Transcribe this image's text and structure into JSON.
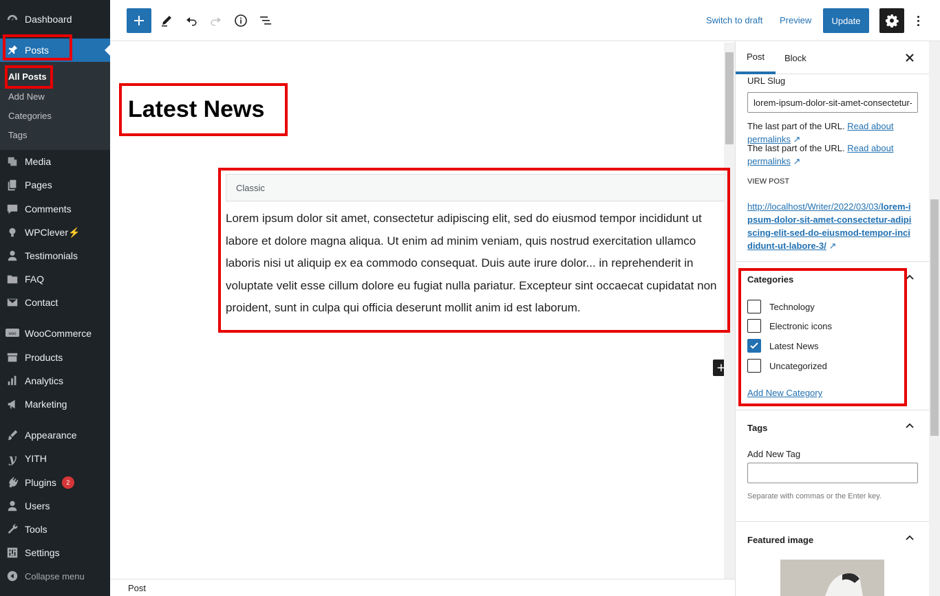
{
  "sidebar": {
    "items": [
      {
        "name": "menu-dashboard",
        "icon": "dashboard-icon",
        "label": "Dashboard"
      },
      {
        "name": "menu-posts",
        "icon": "pushpin-icon",
        "label": "Posts"
      },
      {
        "name": "menu-media",
        "icon": "media-icon",
        "label": "Media"
      },
      {
        "name": "menu-pages",
        "icon": "pages-icon",
        "label": "Pages"
      },
      {
        "name": "menu-comments",
        "icon": "comments-icon",
        "label": "Comments"
      },
      {
        "name": "menu-wpclever",
        "icon": "lightbulb-icon",
        "label": "WPClever⚡"
      },
      {
        "name": "menu-testimonials",
        "icon": "user-icon",
        "label": "Testimonials"
      },
      {
        "name": "menu-faq",
        "icon": "folder-icon",
        "label": "FAQ"
      },
      {
        "name": "menu-contact",
        "icon": "mail-icon",
        "label": "Contact"
      },
      {
        "name": "menu-woocommerce",
        "icon": "woo-icon",
        "label": "WooCommerce"
      },
      {
        "name": "menu-products",
        "icon": "archive-icon",
        "label": "Products"
      },
      {
        "name": "menu-analytics",
        "icon": "bar-chart-icon",
        "label": "Analytics"
      },
      {
        "name": "menu-marketing",
        "icon": "megaphone-icon",
        "label": "Marketing"
      },
      {
        "name": "menu-appearance",
        "icon": "brush-icon",
        "label": "Appearance"
      },
      {
        "name": "menu-yith",
        "icon": "yith-icon",
        "label": "YITH"
      },
      {
        "name": "menu-plugins",
        "icon": "plugin-icon",
        "label": "Plugins"
      },
      {
        "name": "menu-users",
        "icon": "users-icon",
        "label": "Users"
      },
      {
        "name": "menu-tools",
        "icon": "wrench-icon",
        "label": "Tools"
      },
      {
        "name": "menu-settings",
        "icon": "settings-icon",
        "label": "Settings"
      },
      {
        "name": "menu-collapse",
        "icon": "collapse-icon",
        "label": "Collapse menu"
      }
    ],
    "plugins_badge": "2",
    "submenu": [
      "All Posts",
      "Add New",
      "Categories",
      "Tags"
    ]
  },
  "toolbar": {
    "switch_to_draft": "Switch to draft",
    "preview": "Preview",
    "update": "Update"
  },
  "editor": {
    "title": "Latest News",
    "block_label": "Classic",
    "body": "Lorem ipsum dolor sit amet, consectetur adipiscing elit, sed do eiusmod tempor incididunt ut labore et dolore magna aliqua. Ut enim ad minim veniam, quis nostrud exercitation ullamco laboris nisi ut aliquip ex ea commodo consequat. Duis aute irure dolor... in reprehenderit in voluptate velit esse cillum dolore eu fugiat nulla pariatur. Excepteur sint occaecat cupidatat non proident, sunt in culpa qui officia deserunt mollit anim id est laborum.",
    "footer_breadcrumb": "Post"
  },
  "settings": {
    "tabs": [
      "Post",
      "Block"
    ],
    "url_slug_label": "URL Slug",
    "url_slug_value": "lorem-ipsum-dolor-sit-amet-consectetur-adipiscing-elit-sed-do-eiusmod-tempor-incididunt-ut-labore-3",
    "help_prefix": "The last part of the URL.",
    "help_link": "Read about permalinks",
    "view_post_label": "VIEW POST",
    "view_post_url_plain": "http://localhost/Writer/2022/03/03/",
    "view_post_url_bold": "lorem-ipsum-dolor-sit-amet-consectetur-adipiscing-elit-sed-do-eiusmod-tempor-incididunt-ut-labore-3/",
    "categories_title": "Categories",
    "categories": [
      {
        "label": "Technology",
        "checked": false
      },
      {
        "label": "Electronic icons",
        "checked": false
      },
      {
        "label": "Latest News",
        "checked": true
      },
      {
        "label": "Uncategorized",
        "checked": false
      }
    ],
    "add_new_category": "Add New Category",
    "tags_title": "Tags",
    "add_new_tag_label": "Add New Tag",
    "tags_help": "Separate with commas or the Enter key.",
    "featured_image_title": "Featured image"
  },
  "colors": {
    "accent": "#2271b1",
    "sidebar_bg": "#1d2327",
    "highlight_box": "#e80000"
  }
}
